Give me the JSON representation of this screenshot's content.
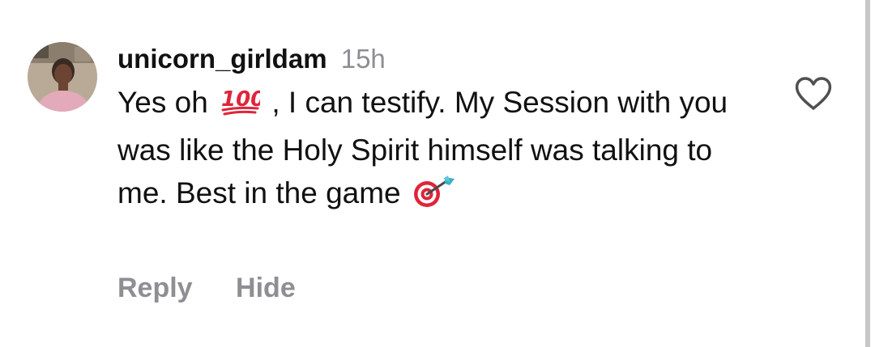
{
  "comment": {
    "username": "unicorn_girldam",
    "time": "15h",
    "text_part1": "Yes oh",
    "emoji_1": "hundred-points-icon",
    "text_part2": ", I can testify. My Session with you was like the Holy Spirit himself was talking to me. Best in the game",
    "emoji_2": "direct-hit-icon"
  },
  "actions": {
    "reply_label": "Reply",
    "hide_label": "Hide"
  },
  "icons": {
    "like": "heart-outline-icon"
  },
  "colors": {
    "primary_text": "#111111",
    "secondary_text": "#8e8e93",
    "emoji_red": "#e0243a",
    "background": "#ffffff"
  }
}
